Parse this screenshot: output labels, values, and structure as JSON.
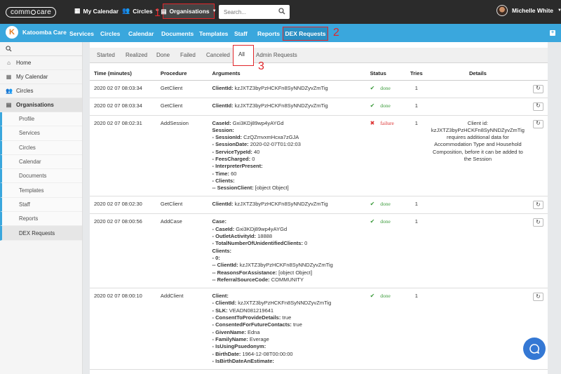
{
  "topbar": {
    "logo_left": "comm",
    "logo_right": "care",
    "my_calendar": "My Calendar",
    "circles": "Circles",
    "organisations": "Organisations",
    "search_placeholder": "Search...",
    "user_name": "Michelle White"
  },
  "annotations": {
    "one": "1",
    "two": "2",
    "three": "3"
  },
  "org_nav": {
    "brand": "Katoomba Care",
    "brand_initial": "K",
    "items": [
      "Services",
      "Circles",
      "Calendar",
      "Documents",
      "Templates",
      "Staff",
      "Reports"
    ],
    "active": "DEX Requests"
  },
  "sidebar": {
    "items": [
      "Home",
      "My Calendar",
      "Circles",
      "Organisations"
    ],
    "sub_items": [
      "Profile",
      "Services",
      "Circles",
      "Calendar",
      "Documents",
      "Templates",
      "Staff",
      "Reports",
      "DEX Requests"
    ]
  },
  "tabs": {
    "items": [
      "Started",
      "Realized",
      "Done",
      "Failed",
      "Canceled"
    ],
    "active": "All",
    "extra": "Admin Requests"
  },
  "table": {
    "headers": [
      "Time (minutes)",
      "Procedure",
      "Arguments",
      "Status",
      "Tries",
      "Details"
    ],
    "rows": [
      {
        "time": "2020 02 07 08:03:34",
        "procedure": "GetClient",
        "args": [
          [
            "ClientId:",
            " kzJXTZ3byPzHCKFn8SyNNDZyvZmTig"
          ]
        ],
        "status": "done",
        "tries": "1",
        "details": ""
      },
      {
        "time": "2020 02 07 08:03:34",
        "procedure": "GetClient",
        "args": [
          [
            "ClientId:",
            " kzJXTZ3byPzHCKFn8SyNNDZyvZmTig"
          ]
        ],
        "status": "done",
        "tries": "1",
        "details": ""
      },
      {
        "time": "2020 02 07 08:02:31",
        "procedure": "AddSession",
        "args": [
          [
            "CaseId:",
            " Gxi3KDj89wp4yAYGd"
          ],
          [
            "Session:",
            ""
          ],
          [
            "- SessionId:",
            " CzQZmvxmHcxa7zGJA"
          ],
          [
            "- SessionDate:",
            " 2020-02-07T01:02:03"
          ],
          [
            "- ServiceTypeId:",
            " 40"
          ],
          [
            "- FeesCharged:",
            " 0"
          ],
          [
            "- InterpreterPresent:",
            ""
          ],
          [
            "- Time:",
            " 60"
          ],
          [
            "- Clients:",
            ""
          ],
          [
            "-- SessionClient:",
            " [object Object]"
          ]
        ],
        "status": "failure",
        "tries": "1",
        "details": "Client id: kzJXTZ3byPzHCKFn8SyNNDZyvZmTig requires additional data for Accommodation Type and Household Composition, before it can be added to the Session"
      },
      {
        "time": "2020 02 07 08:02:30",
        "procedure": "GetClient",
        "args": [
          [
            "ClientId:",
            " kzJXTZ3byPzHCKFn8SyNNDZyvZmTig"
          ]
        ],
        "status": "done",
        "tries": "1",
        "details": ""
      },
      {
        "time": "2020 02 07 08:00:56",
        "procedure": "AddCase",
        "args": [
          [
            "Case:",
            ""
          ],
          [
            "- CaseId:",
            " Gxi3KDj89wp4yAYGd"
          ],
          [
            "- OutletActivityId:",
            " 18888"
          ],
          [
            "- TotalNumberOfUnidentifiedClients:",
            " 0"
          ],
          [
            "Clients:",
            ""
          ],
          [
            "- 0:",
            ""
          ],
          [
            "-- ClientId:",
            " kzJXTZ3byPzHCKFn8SyNNDZyvZmTig"
          ],
          [
            "-- ReasonsForAssistance:",
            " [object Object]"
          ],
          [
            "-- ReferralSourceCode:",
            " COMMUNITY"
          ]
        ],
        "status": "done",
        "tries": "1",
        "details": ""
      },
      {
        "time": "2020 02 07 08:00:10",
        "procedure": "AddClient",
        "args": [
          [
            "Client:",
            ""
          ],
          [
            "- ClientId:",
            " kzJXTZ3byPzHCKFn8SyNNDZyvZmTig"
          ],
          [
            "- SLK:",
            " VEADN081219641"
          ],
          [
            "- ConsentToProvideDetails:",
            " true"
          ],
          [
            "- ConsentedForFutureContacts:",
            " true"
          ],
          [
            "- GivenName:",
            " Edna"
          ],
          [
            "- FamilyName:",
            " Everage"
          ],
          [
            "- IsUsingPsuedonym:",
            ""
          ],
          [
            "- BirthDate:",
            " 1964-12-08T00:00:00"
          ],
          [
            "- IsBirthDateAnEstimate:",
            ""
          ]
        ],
        "status": "done",
        "tries": "1",
        "details": ""
      }
    ]
  },
  "colors": {
    "topbar": "#2b2b2b",
    "accent": "#3aa7dd",
    "annotation": "#e1262a",
    "done": "#3a9a3a",
    "failure": "#d33333"
  }
}
